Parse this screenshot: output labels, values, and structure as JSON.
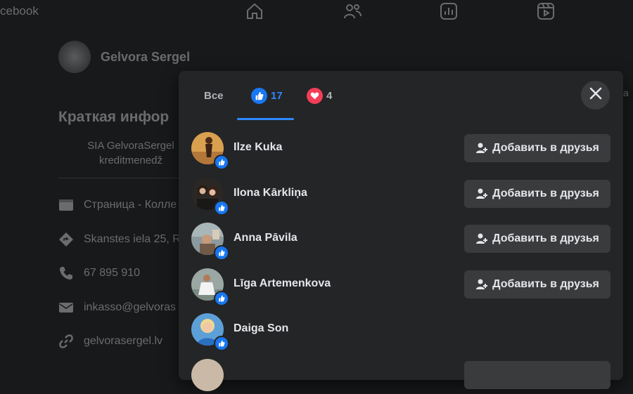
{
  "brand": "cebook",
  "nav": [
    "home-icon",
    "friends-icon",
    "dashboard-icon",
    "video-icon"
  ],
  "profile": {
    "name": "Gelvora Sergel",
    "intro_title": "Краткая инфор",
    "intro_text": "SIA GelvoraSergel kreditmenedž",
    "info": [
      {
        "icon": "page-icon",
        "text": "Страница - Колле"
      },
      {
        "icon": "location-icon",
        "text": "Skanstes iela 25, R"
      },
      {
        "icon": "phone-icon",
        "text": "67 895 910"
      },
      {
        "icon": "email-icon",
        "text": "inkasso@gelvoras"
      },
      {
        "icon": "link-icon",
        "text": "gelvorasergel.lv"
      }
    ]
  },
  "reactions_dialog": {
    "tabs": {
      "all_label": "Все",
      "like_count": "17",
      "love_count": "4"
    },
    "people": [
      {
        "name": "Ilze Kuka",
        "button": "Добавить в друзья"
      },
      {
        "name": "Ilona Kārkliņa",
        "button": "Добавить в друзья"
      },
      {
        "name": "Anna Pāvila",
        "button": "Добавить в друзья"
      },
      {
        "name": "Līga Artemenkova",
        "button": "Добавить в друзья"
      },
      {
        "name": "Daiga Son",
        "button": ""
      }
    ]
  },
  "colors": {
    "background": "#18191a",
    "dialog": "#242526",
    "accent": "#2d88ff",
    "love": "#f33e58",
    "button": "#3a3b3c"
  }
}
